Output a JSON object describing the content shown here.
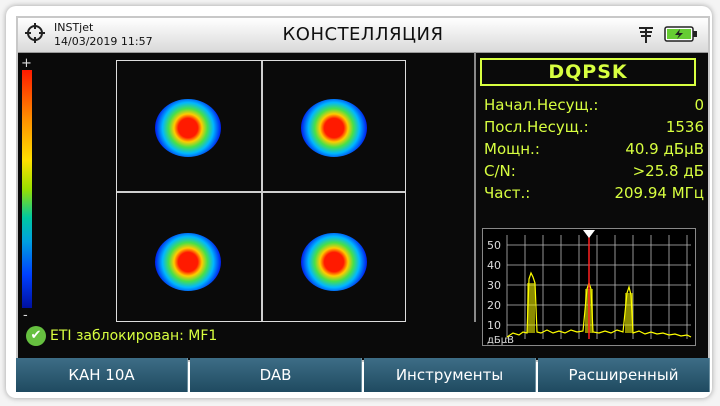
{
  "header": {
    "device_name": "INSTjet",
    "datetime": "14/03/2019 11:57",
    "title": "КОНСТЕЛЛЯЦИЯ",
    "icons": [
      "target-icon",
      "antenna-icon",
      "battery-plug-icon"
    ]
  },
  "colorbar": {
    "plus": "+",
    "minus": "-"
  },
  "panel": {
    "modulation": "DQPSK",
    "rows": [
      {
        "label": "Начал.Несущ.:",
        "value": "0"
      },
      {
        "label": "Посл.Несущ.:",
        "value": "1536"
      },
      {
        "label": "Мощн.:",
        "value": "40.9 дБμВ"
      },
      {
        "label": "C/N:",
        "value": ">25.8 дБ"
      },
      {
        "label": "Част.:",
        "value": "209.94 МГц"
      }
    ]
  },
  "spectrum": {
    "y_ticks": [
      "50",
      "40",
      "30",
      "20",
      "10"
    ],
    "unit": "дБμВ",
    "colors": {
      "trace": "#ffff00",
      "marker": "#ff2020",
      "grid": "#bbbbbb"
    }
  },
  "status": {
    "text": "ETI заблокирован: MF1"
  },
  "softkeys": [
    "КАН 10А",
    "DAB",
    "Инструменты",
    "Расширенный"
  ],
  "colors": {
    "accent": "#d8ff40",
    "softkey": "#2d5b72"
  }
}
